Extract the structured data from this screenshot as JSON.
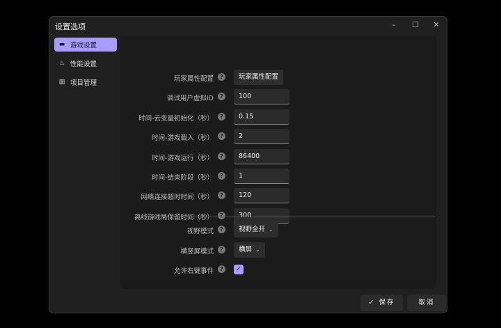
{
  "window": {
    "title": "设置选项",
    "minimize": "–",
    "maximize": "☐",
    "close": "✕"
  },
  "sidebar": {
    "items": [
      {
        "label": "游戏设置",
        "icon": "folder-icon",
        "active": true
      },
      {
        "label": "性能设置",
        "icon": "flame-icon"
      },
      {
        "label": "项目管理",
        "icon": "books-icon"
      }
    ]
  },
  "settings": [
    {
      "label": "玩家属性配置",
      "type": "button",
      "value": "玩家属性配置"
    },
    {
      "label": "调试用户虚拟ID",
      "type": "input",
      "value": "100"
    },
    {
      "label": "时间-云变量初始化（秒）",
      "type": "input",
      "value": "0.15"
    },
    {
      "label": "时间-游戏载入（秒）",
      "type": "input",
      "value": "2"
    },
    {
      "label": "时间-游戏运行（秒）",
      "type": "input",
      "value": "86400"
    },
    {
      "label": "时间-结束阶段（秒）",
      "type": "input",
      "value": "1"
    },
    {
      "label": "网络连接超时时间（秒）",
      "type": "input",
      "value": "120"
    },
    {
      "label": "离线游戏局保留时间（秒）",
      "type": "input",
      "value": "300"
    }
  ],
  "view": {
    "label": "视野模式",
    "value": "视野全开"
  },
  "orientation": {
    "label": "横竖屏模式",
    "value": "横屏"
  },
  "rightclick": {
    "label": "允许右键事件",
    "checked": true
  },
  "footer": {
    "save": "✓ 保存",
    "cancel": "取消"
  },
  "colors": {
    "accent": "#a99cff"
  }
}
